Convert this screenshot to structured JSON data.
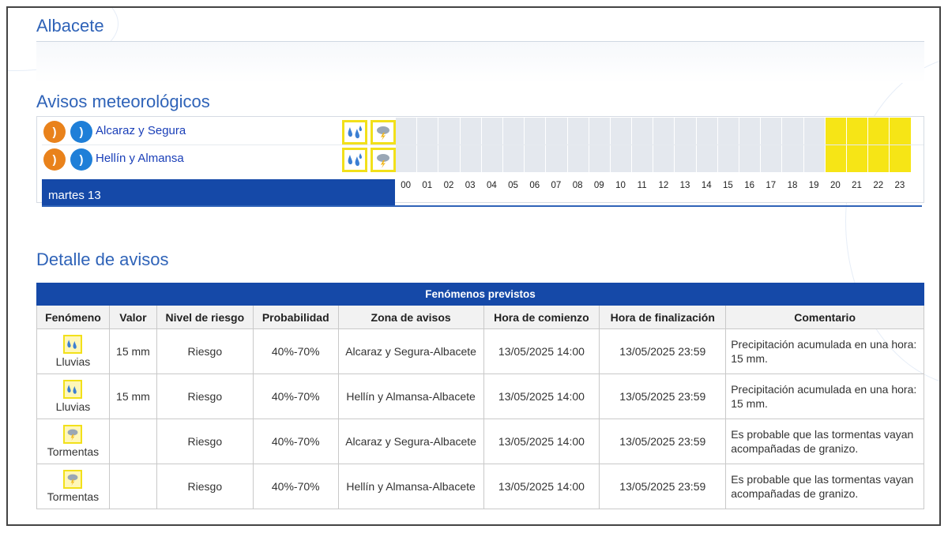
{
  "city": {
    "title": "Albacete"
  },
  "avisos": {
    "title": "Avisos meteorológicos",
    "zones": [
      {
        "name": "Alcaraz y Segura",
        "hours_warned": [
          20,
          21,
          22,
          23
        ]
      },
      {
        "name": "Hellín y Almansa",
        "hours_warned": [
          20,
          21,
          22,
          23
        ]
      }
    ],
    "day_label": "martes 13",
    "hours": [
      "00",
      "01",
      "02",
      "03",
      "04",
      "05",
      "06",
      "07",
      "08",
      "09",
      "10",
      "11",
      "12",
      "13",
      "14",
      "15",
      "16",
      "17",
      "18",
      "19",
      "20",
      "21",
      "22",
      "23"
    ],
    "icons": [
      "rss-orange-icon",
      "rss-blue-icon",
      "rain-icon",
      "thunderstorm-icon"
    ],
    "colors": {
      "warning_yellow": "#f6e516",
      "no_warning": "#e4e8ee",
      "header_blue": "#1549a8"
    }
  },
  "detalle": {
    "title": "Detalle de avisos",
    "group_header": "Fenómenos previstos",
    "columns": [
      "Fenómeno",
      "Valor",
      "Nivel de riesgo",
      "Probabilidad",
      "Zona de avisos",
      "Hora de comienzo",
      "Hora de finalización",
      "Comentario"
    ],
    "rows": [
      {
        "fenomeno": "Lluvias",
        "icon": "rain-icon",
        "valor": "15 mm",
        "nivel": "Riesgo",
        "probabilidad": "40%-70%",
        "zona": "Alcaraz y Segura-Albacete",
        "inicio": "13/05/2025 14:00",
        "fin": "13/05/2025 23:59",
        "comentario": "Precipitación acumulada en una hora: 15 mm."
      },
      {
        "fenomeno": "Lluvias",
        "icon": "rain-icon",
        "valor": "15 mm",
        "nivel": "Riesgo",
        "probabilidad": "40%-70%",
        "zona": "Hellín y Almansa-Albacete",
        "inicio": "13/05/2025 14:00",
        "fin": "13/05/2025 23:59",
        "comentario": "Precipitación acumulada en una hora: 15 mm."
      },
      {
        "fenomeno": "Tormentas",
        "icon": "thunderstorm-icon",
        "valor": "",
        "nivel": "Riesgo",
        "probabilidad": "40%-70%",
        "zona": "Alcaraz y Segura-Albacete",
        "inicio": "13/05/2025 14:00",
        "fin": "13/05/2025 23:59",
        "comentario": "Es probable que las tormentas vayan acompañadas de granizo."
      },
      {
        "fenomeno": "Tormentas",
        "icon": "thunderstorm-icon",
        "valor": "",
        "nivel": "Riesgo",
        "probabilidad": "40%-70%",
        "zona": "Hellín y Almansa-Albacete",
        "inicio": "13/05/2025 14:00",
        "fin": "13/05/2025 23:59",
        "comentario": "Es probable que las tormentas vayan acompañadas de granizo."
      }
    ]
  }
}
